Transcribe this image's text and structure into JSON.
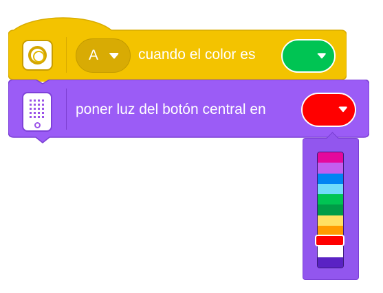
{
  "event_block": {
    "color": "#f3c300",
    "icon": "color-sensor-icon",
    "port": "A",
    "text": "cuando el color es",
    "selected_color": "#00c453"
  },
  "action_block": {
    "color": "#9b5cf6",
    "icon": "hub-matrix-icon",
    "text": "poner luz del botón central en",
    "selected_color": "#ff0000"
  },
  "color_palette": {
    "colors": [
      {
        "name": "magenta",
        "hex": "#e5089c"
      },
      {
        "name": "violet",
        "hex": "#c35ef0"
      },
      {
        "name": "blue",
        "hex": "#0084f3"
      },
      {
        "name": "azure",
        "hex": "#6fdcfb"
      },
      {
        "name": "green",
        "hex": "#00c453"
      },
      {
        "name": "dark-green",
        "hex": "#009c47"
      },
      {
        "name": "yellow",
        "hex": "#ffe062"
      },
      {
        "name": "orange",
        "hex": "#ff9b00"
      },
      {
        "name": "red",
        "hex": "#ff0000"
      },
      {
        "name": "white",
        "hex": "#ffffff"
      },
      {
        "name": "off",
        "hex": "#5a22c4"
      }
    ],
    "selected": "red"
  }
}
